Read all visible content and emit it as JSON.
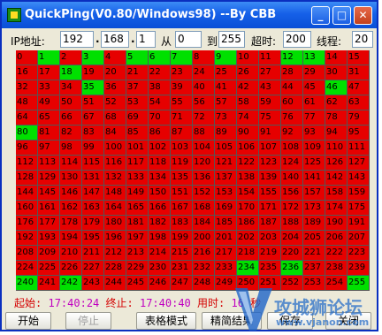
{
  "window": {
    "title": "QuickPing(V0.80/Windows98) --By CBB",
    "min_glyph": "_",
    "max_glyph": "□",
    "close_glyph": "✕"
  },
  "toolbar": {
    "ip_label": "IP地址:",
    "ip1": "192",
    "ip2": "168",
    "ip3": "1",
    "dot": ".",
    "from_label": "从",
    "from_value": "0",
    "to_label": "到",
    "to_value": "255",
    "timeout_label": "超时:",
    "timeout_value": "200",
    "threads_label": "线程:",
    "threads_value": "20"
  },
  "grid": {
    "count": 256,
    "columns": 16,
    "responding": [
      1,
      3,
      5,
      6,
      7,
      9,
      12,
      13,
      18,
      35,
      46,
      80,
      234,
      236,
      240,
      242,
      255
    ],
    "colors": {
      "responding": "#00e000",
      "no_response": "#e60000"
    }
  },
  "status": {
    "start_label": "起始:",
    "start_time": "17:40:24",
    "end_label": "终止:",
    "end_time": "17:40:40",
    "elapsed_label": "用时:",
    "elapsed_value": "16",
    "unit": "秒"
  },
  "buttons": {
    "start": "开始",
    "stop": "停止",
    "table_mode": "表格模式",
    "refine": "精简结果",
    "save": "保存",
    "close": "关闭"
  },
  "watermark": {
    "text": "攻城狮论坛",
    "url": "www.vjanon.com"
  }
}
